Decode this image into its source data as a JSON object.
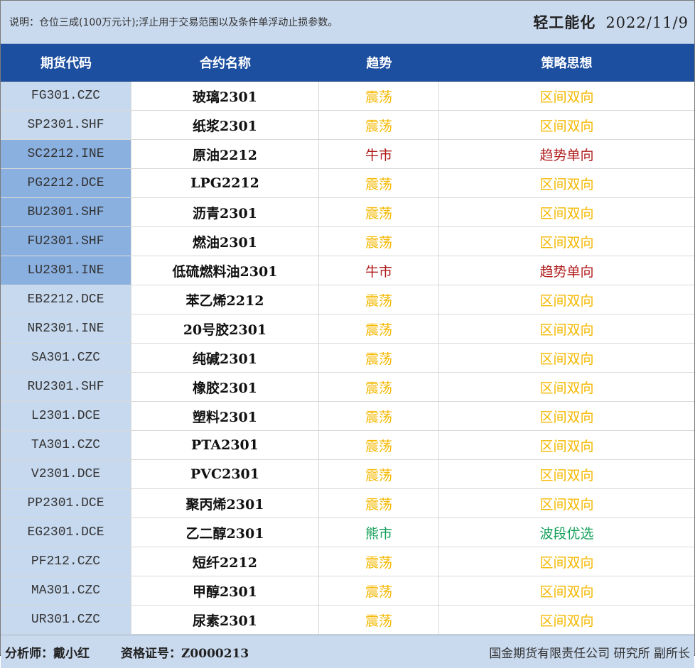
{
  "note": "说明：仓位三成(100万元计);浮止用于交易范围以及条件单浮动止损参数。",
  "title": "轻工能化",
  "date": "2022/11/9",
  "headers": [
    "期货代码",
    "合约名称",
    "趋势",
    "策略思想"
  ],
  "colors": {
    "range": "#f5b800",
    "bull": "#b01c1c",
    "bear": "#14a05a",
    "header_bg": "#1d4fa0",
    "code_bg": "#c7d9ef",
    "code_highlight_bg": "#8ab0e0"
  },
  "rows": [
    {
      "code": "FG301.CZC",
      "name": "玻璃2301",
      "trend": "震荡",
      "strategy": "区间双向",
      "type": "range",
      "hl": false
    },
    {
      "code": "SP2301.SHF",
      "name": "纸浆2301",
      "trend": "震荡",
      "strategy": "区间双向",
      "type": "range",
      "hl": false
    },
    {
      "code": "SC2212.INE",
      "name": "原油2212",
      "trend": "牛市",
      "strategy": "趋势单向",
      "type": "bull",
      "hl": true
    },
    {
      "code": "PG2212.DCE",
      "name": "LPG2212",
      "trend": "震荡",
      "strategy": "区间双向",
      "type": "range",
      "hl": true
    },
    {
      "code": "BU2301.SHF",
      "name": "沥青2301",
      "trend": "震荡",
      "strategy": "区间双向",
      "type": "range",
      "hl": true
    },
    {
      "code": "FU2301.SHF",
      "name": "燃油2301",
      "trend": "震荡",
      "strategy": "区间双向",
      "type": "range",
      "hl": true
    },
    {
      "code": "LU2301.INE",
      "name": "低硫燃料油2301",
      "trend": "牛市",
      "strategy": "趋势单向",
      "type": "bull",
      "hl": true
    },
    {
      "code": "EB2212.DCE",
      "name": "苯乙烯2212",
      "trend": "震荡",
      "strategy": "区间双向",
      "type": "range",
      "hl": false
    },
    {
      "code": "NR2301.INE",
      "name": "20号胶2301",
      "trend": "震荡",
      "strategy": "区间双向",
      "type": "range",
      "hl": false
    },
    {
      "code": "SA301.CZC",
      "name": "纯碱2301",
      "trend": "震荡",
      "strategy": "区间双向",
      "type": "range",
      "hl": false
    },
    {
      "code": "RU2301.SHF",
      "name": "橡胶2301",
      "trend": "震荡",
      "strategy": "区间双向",
      "type": "range",
      "hl": false
    },
    {
      "code": "L2301.DCE",
      "name": "塑料2301",
      "trend": "震荡",
      "strategy": "区间双向",
      "type": "range",
      "hl": false
    },
    {
      "code": "TA301.CZC",
      "name": "PTA2301",
      "trend": "震荡",
      "strategy": "区间双向",
      "type": "range",
      "hl": false
    },
    {
      "code": "V2301.DCE",
      "name": "PVC2301",
      "trend": "震荡",
      "strategy": "区间双向",
      "type": "range",
      "hl": false
    },
    {
      "code": "PP2301.DCE",
      "name": "聚丙烯2301",
      "trend": "震荡",
      "strategy": "区间双向",
      "type": "range",
      "hl": false
    },
    {
      "code": "EG2301.DCE",
      "name": "乙二醇2301",
      "trend": "熊市",
      "strategy": "波段优选",
      "type": "bear",
      "hl": false
    },
    {
      "code": "PF212.CZC",
      "name": "短纤2212",
      "trend": "震荡",
      "strategy": "区间双向",
      "type": "range",
      "hl": false
    },
    {
      "code": "MA301.CZC",
      "name": "甲醇2301",
      "trend": "震荡",
      "strategy": "区间双向",
      "type": "range",
      "hl": false
    },
    {
      "code": "UR301.CZC",
      "name": "尿素2301",
      "trend": "震荡",
      "strategy": "区间双向",
      "type": "range",
      "hl": false
    }
  ],
  "footer": {
    "analyst": "分析师：戴小红",
    "license": "资格证号：Z0000213",
    "company": "国金期货有限责任公司 研究所 副所长"
  }
}
